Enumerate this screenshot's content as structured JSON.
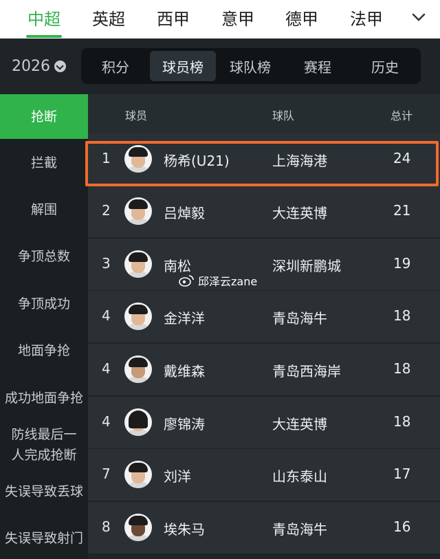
{
  "leagues": [
    "中超",
    "英超",
    "西甲",
    "意甲",
    "德甲",
    "法甲"
  ],
  "season": "2026",
  "subtabs": [
    "积分",
    "球员榜",
    "球队榜",
    "赛程",
    "历史"
  ],
  "side_menu": [
    "抢断",
    "拦截",
    "解围",
    "争顶总数",
    "争顶成功",
    "地面争抢",
    "成功地面争抢",
    "防线最后一人完成抢断",
    "失误导致丢球",
    "失误导致射门"
  ],
  "table": {
    "headers": {
      "player": "球员",
      "team": "球队",
      "total": "总计"
    },
    "rows": [
      {
        "rank": "1",
        "name": "杨希(U21)",
        "team": "上海海港",
        "total": "24"
      },
      {
        "rank": "2",
        "name": "吕焯毅",
        "team": "大连英博",
        "total": "21"
      },
      {
        "rank": "3",
        "name": "南松",
        "team": "深圳新鹏城",
        "total": "19"
      },
      {
        "rank": "4",
        "name": "金洋洋",
        "team": "青岛海牛",
        "total": "18"
      },
      {
        "rank": "4",
        "name": "戴维森",
        "team": "青岛西海岸",
        "total": "18"
      },
      {
        "rank": "4",
        "name": "廖锦涛",
        "team": "大连英博",
        "total": "18"
      },
      {
        "rank": "7",
        "name": "刘洋",
        "team": "山东泰山",
        "total": "17"
      },
      {
        "rank": "8",
        "name": "埃朱马",
        "team": "青岛海牛",
        "total": "16"
      }
    ]
  },
  "watermark": "邱泽云zane",
  "colors": {
    "accent": "#2fb34a",
    "highlight": "#f26a2e",
    "background": "#1e2428"
  }
}
